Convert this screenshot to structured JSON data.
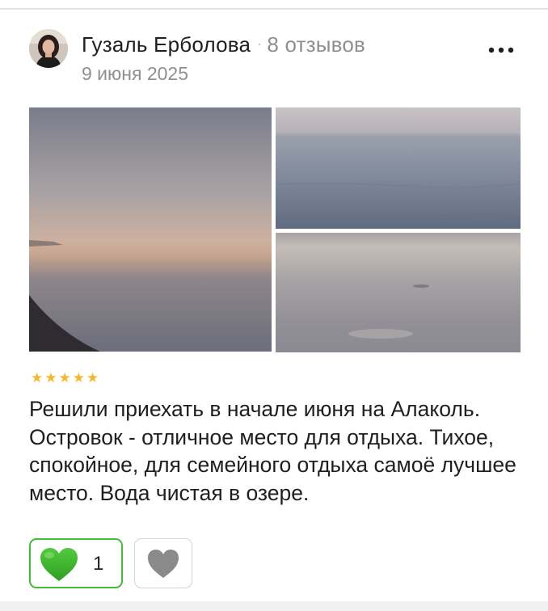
{
  "review": {
    "author_name": "Гузаль Ерболова",
    "separator": "·",
    "reviews_count": "8 отзывов",
    "date": "9 июня 2025",
    "rating": 5,
    "rating_max": 5,
    "text": "Решили приехать в начале июня на Алаколь. Островок - отличное место для отдыха. Тихое, спокойное, для семейного отдыха самоё лучшее место. Вода чистая в озере.",
    "likes": "1",
    "photos_count": 3
  },
  "colors": {
    "star": "#f5b731",
    "like_border": "#47b83b",
    "like_heart": "#3cb828",
    "dislike_heart": "#8a8a8a"
  },
  "icons": {
    "more": "more-dots-icon",
    "like": "heart-filled-green-icon",
    "dislike": "heart-gray-icon"
  }
}
